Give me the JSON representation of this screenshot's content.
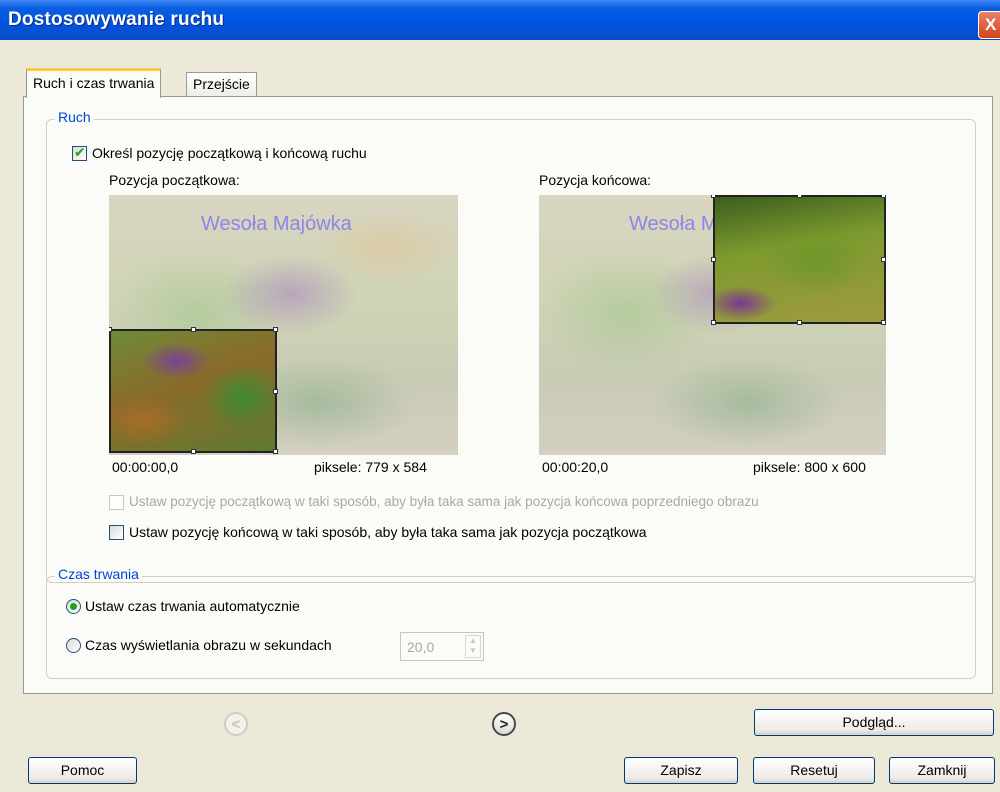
{
  "window": {
    "title": "Dostosowywanie ruchu",
    "close_glyph": "X"
  },
  "tabs": [
    {
      "label": "Ruch i czas trwania",
      "active": true
    },
    {
      "label": "Przejście",
      "active": false
    }
  ],
  "motion": {
    "legend": "Ruch",
    "define_checkbox": {
      "label": "Określ pozycję początkową i końcową ruchu",
      "checked": true
    },
    "start": {
      "label": "Pozycja początkowa:",
      "time": "00:00:00,0",
      "pixels": "piksele: 779 x 584",
      "watermark": "Wesoła Majówka"
    },
    "end": {
      "label": "Pozycja końcowa:",
      "time": "00:00:20,0",
      "pixels": "piksele: 800 x 600",
      "watermark": "Wesoła Majówka"
    },
    "same_as_prev_checkbox": {
      "label": "Ustaw pozycję początkową w taki sposób, aby była taka sama jak pozycja końcowa poprzedniego obrazu",
      "checked": false,
      "enabled": false
    },
    "same_as_start_checkbox": {
      "label": "Ustaw pozycję końcową w taki sposób, aby była taka sama jak pozycja początkowa",
      "checked": false,
      "enabled": true
    }
  },
  "duration": {
    "legend": "Czas trwania",
    "auto_radio": {
      "label": "Ustaw czas trwania automatycznie",
      "checked": true
    },
    "seconds_radio": {
      "label": "Czas wyświetlania obrazu w sekundach",
      "checked": false
    },
    "seconds_value": "20,0"
  },
  "buttons": {
    "preview": "Podgląd...",
    "help": "Pomoc",
    "save": "Zapisz",
    "reset": "Resetuj",
    "close": "Zamknij"
  },
  "nav": {
    "prev_glyph": "<",
    "next_glyph": ">",
    "prev_enabled": false,
    "next_enabled": true
  },
  "colors": {
    "accent": "#0046d5",
    "title_bar": "#0054e3",
    "check": "#21a121",
    "disabled_text": "#aca899"
  }
}
